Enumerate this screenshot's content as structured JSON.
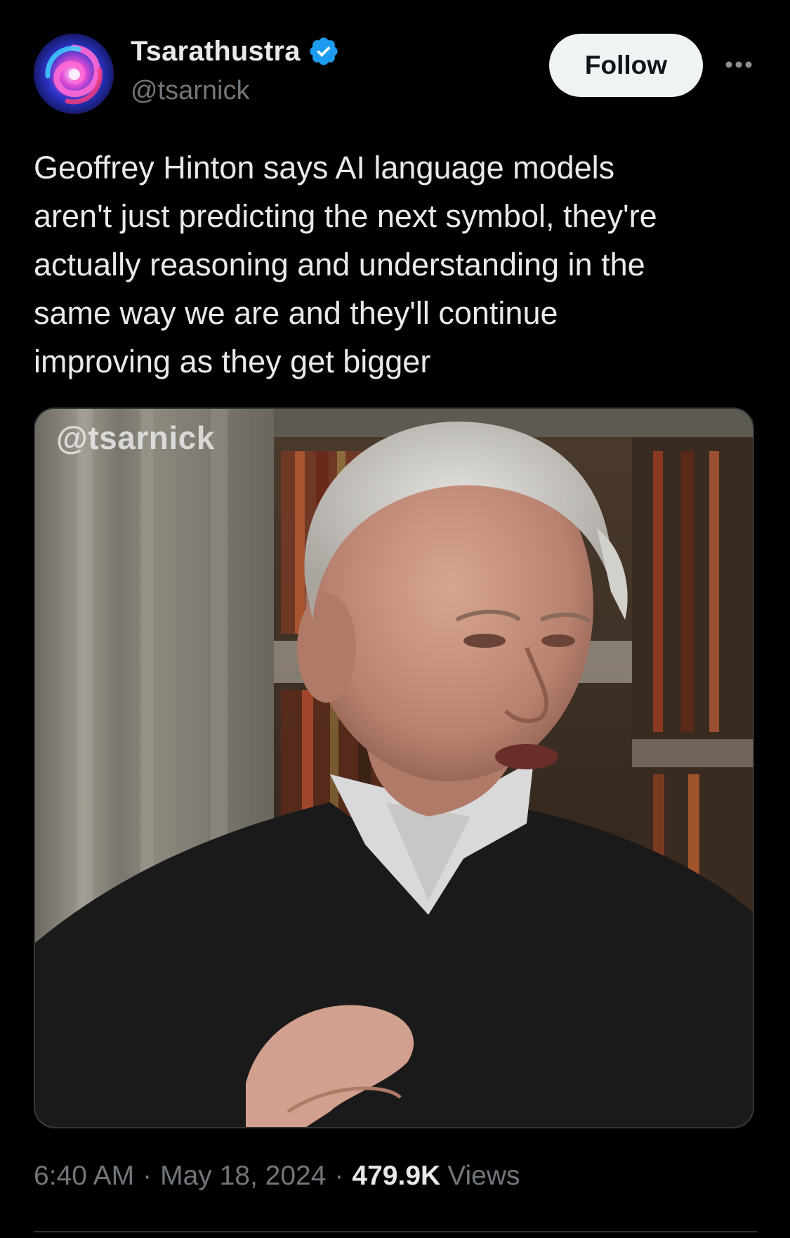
{
  "author": {
    "display_name": "Tsarathustra",
    "handle": "@tsarnick",
    "verified": true,
    "avatar_icon": "swirl-avatar"
  },
  "actions": {
    "follow_label": "Follow",
    "more_icon": "ellipsis-icon"
  },
  "tweet": {
    "text": "Geoffrey Hinton says AI language models\naren't just predicting the next symbol, they're\nactually reasoning and understanding in the\nsame way we are and they'll continue\nimproving as they get bigger"
  },
  "media": {
    "watermark": "@tsarnick"
  },
  "meta": {
    "time": "6:40 AM",
    "date": "May 18, 2024",
    "separator": "·",
    "views_count": "479.9K",
    "views_label": "Views"
  },
  "colors": {
    "background": "#000000",
    "text_primary": "#e7e9ea",
    "text_secondary": "#71767b",
    "verified_blue": "#1d9bf0",
    "follow_bg": "#eff3f4"
  }
}
